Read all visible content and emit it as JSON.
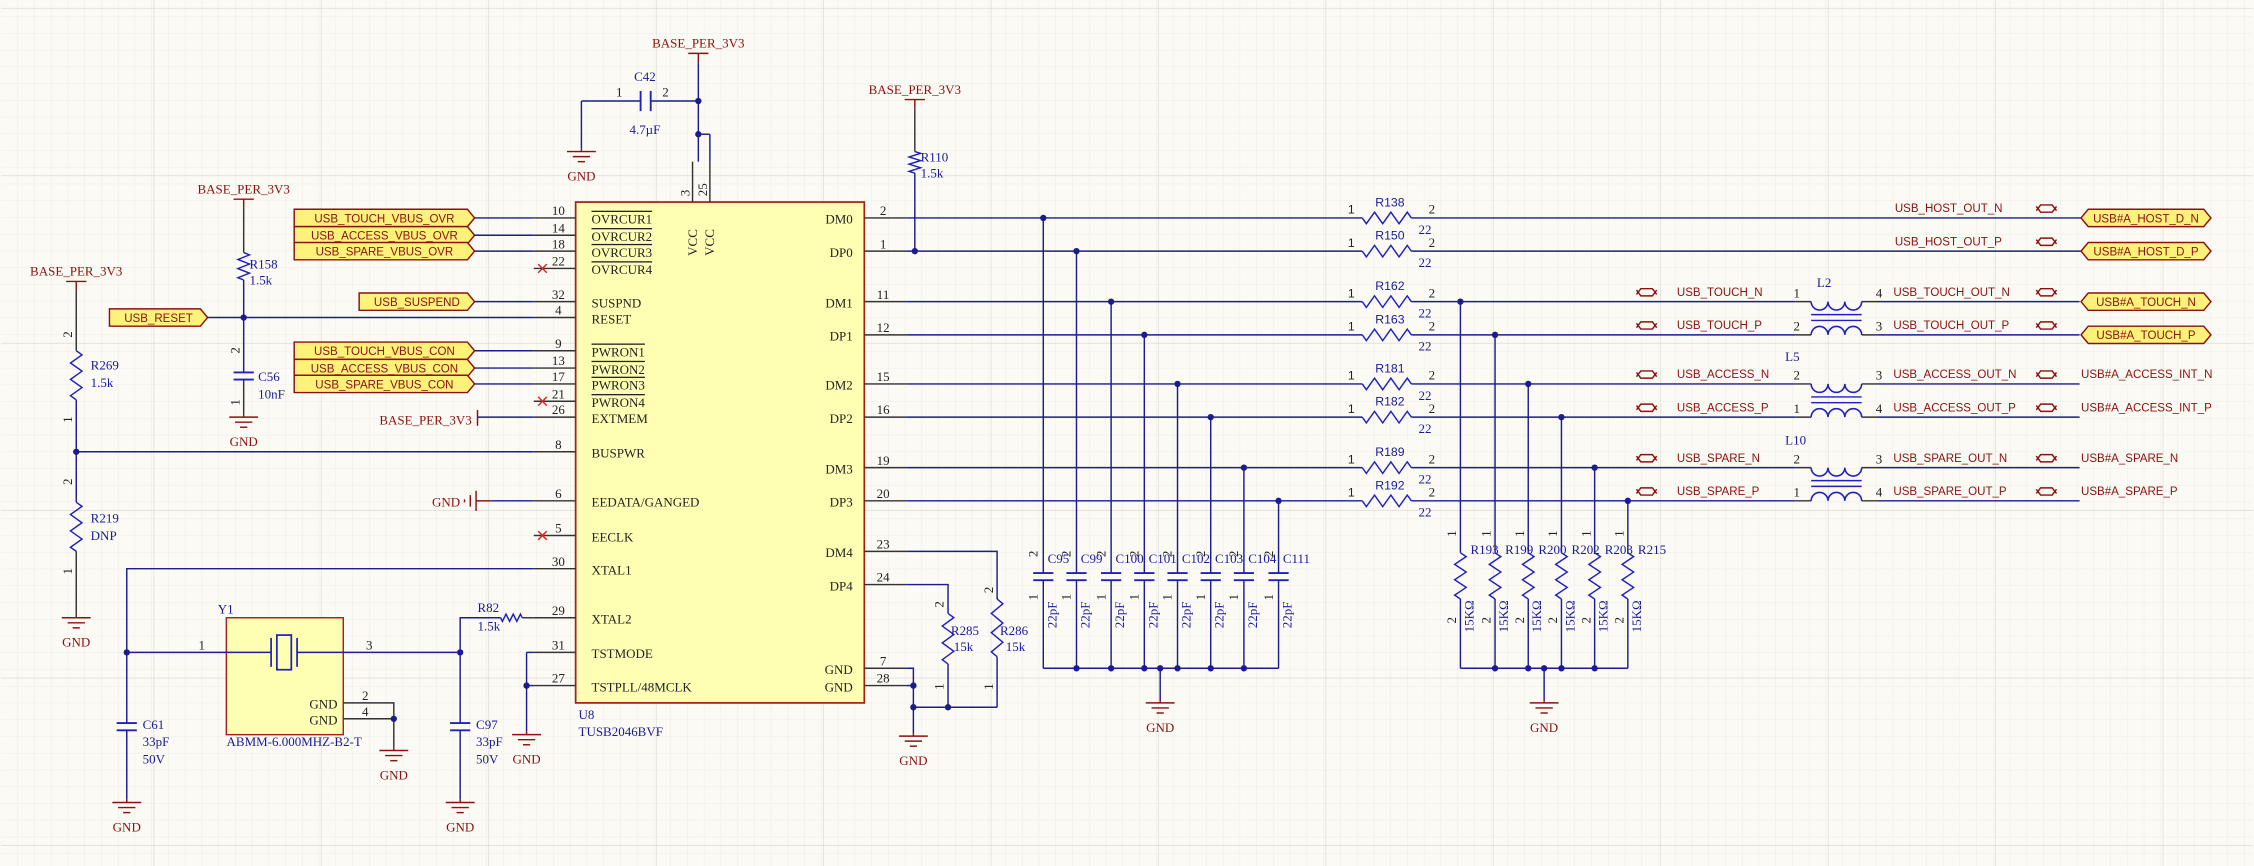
{
  "nets": {
    "power": "BASE_PER_3V3",
    "gnd": "GND"
  },
  "colors": {
    "wire": "#1c1c8f",
    "net_label": "#8b1010",
    "component_text": "#1a1a9a",
    "ic_fill": "#ffffb4",
    "ic_border": "#a02020",
    "port_fill": "#fff27a"
  },
  "u8": {
    "ref": "U8",
    "part": "TUSB2046BVF",
    "top": [
      {
        "num": "3",
        "name": "VCC"
      },
      {
        "num": "25",
        "name": "VCC"
      }
    ],
    "left": [
      {
        "num": "10",
        "name": "OVRCUR1",
        "active_low": true
      },
      {
        "num": "14",
        "name": "OVRCUR2",
        "active_low": true
      },
      {
        "num": "18",
        "name": "OVRCUR3",
        "active_low": true
      },
      {
        "num": "22",
        "name": "OVRCUR4",
        "active_low": true,
        "no_connect": true
      },
      {
        "num": "32",
        "name": "SUSPND"
      },
      {
        "num": "4",
        "name": "RESET"
      },
      {
        "num": "9",
        "name": "PWRON1",
        "active_low": true
      },
      {
        "num": "13",
        "name": "PWRON2",
        "active_low": true
      },
      {
        "num": "17",
        "name": "PWRON3",
        "active_low": true
      },
      {
        "num": "21",
        "name": "PWRON4",
        "active_low": true,
        "no_connect": true
      },
      {
        "num": "26",
        "name": "EXTMEM"
      },
      {
        "num": "8",
        "name": "BUSPWR"
      },
      {
        "num": "6",
        "name": "EEDATA/GANGED"
      },
      {
        "num": "5",
        "name": "EECLK",
        "no_connect": true
      },
      {
        "num": "30",
        "name": "XTAL1"
      },
      {
        "num": "29",
        "name": "XTAL2"
      },
      {
        "num": "31",
        "name": "TSTMODE"
      },
      {
        "num": "27",
        "name": "TSTPLL/48MCLK"
      }
    ],
    "right": [
      {
        "num": "2",
        "name": "DM0"
      },
      {
        "num": "1",
        "name": "DP0"
      },
      {
        "num": "11",
        "name": "DM1"
      },
      {
        "num": "12",
        "name": "DP1"
      },
      {
        "num": "15",
        "name": "DM2"
      },
      {
        "num": "16",
        "name": "DP2"
      },
      {
        "num": "19",
        "name": "DM3"
      },
      {
        "num": "20",
        "name": "DP3"
      },
      {
        "num": "23",
        "name": "DM4"
      },
      {
        "num": "24",
        "name": "DP4"
      },
      {
        "num": "7",
        "name": "GND"
      },
      {
        "num": "28",
        "name": "GND"
      }
    ]
  },
  "ports_left": {
    "ovr": [
      "USB_TOUCH_VBUS_OVR",
      "USB_ACCESS_VBUS_OVR",
      "USB_SPARE_VBUS_OVR"
    ],
    "suspend": "USB_SUSPEND",
    "reset": "USB_RESET",
    "con": [
      "USB_TOUCH_VBUS_CON",
      "USB_ACCESS_VBUS_CON",
      "USB_SPARE_VBUS_CON"
    ]
  },
  "pin_numbers": {
    "one": "1",
    "two": "2",
    "three": "3",
    "four": "4"
  },
  "components": {
    "C42": {
      "ref": "C42",
      "value": "4.7µF"
    },
    "R158": {
      "ref": "R158",
      "value": "1.5k"
    },
    "C56": {
      "ref": "C56",
      "value": "10nF"
    },
    "R269": {
      "ref": "R269",
      "value": "1.5k"
    },
    "R219": {
      "ref": "R219",
      "value": "DNP"
    },
    "R110": {
      "ref": "R110",
      "value": "1.5k"
    },
    "R82": {
      "ref": "R82",
      "value": "1.5k"
    },
    "C61": {
      "ref": "C61",
      "value": "33pF",
      "voltage": "50V"
    },
    "C97": {
      "ref": "C97",
      "value": "33pF",
      "voltage": "50V"
    },
    "Y1": {
      "ref": "Y1",
      "part": "ABMM-6.000MHZ-B2-T",
      "pin_labels": [
        "GND",
        "GND"
      ]
    },
    "R285": {
      "ref": "R285",
      "value": "15k"
    },
    "R286": {
      "ref": "R286",
      "value": "15k"
    }
  },
  "series_resistors": [
    {
      "ref": "R138",
      "value": "22"
    },
    {
      "ref": "R150",
      "value": "22"
    },
    {
      "ref": "R162",
      "value": "22"
    },
    {
      "ref": "R163",
      "value": "22"
    },
    {
      "ref": "R181",
      "value": "22"
    },
    {
      "ref": "R182",
      "value": "22"
    },
    {
      "ref": "R189",
      "value": "22"
    },
    {
      "ref": "R192",
      "value": "22"
    }
  ],
  "filter_caps": [
    {
      "ref": "C95",
      "value": "22pF"
    },
    {
      "ref": "C99",
      "value": "22pF"
    },
    {
      "ref": "C100",
      "value": "22pF"
    },
    {
      "ref": "C101",
      "value": "22pF"
    },
    {
      "ref": "C102",
      "value": "22pF"
    },
    {
      "ref": "C103",
      "value": "22pF"
    },
    {
      "ref": "C104",
      "value": "22pF"
    },
    {
      "ref": "C111",
      "value": "22pF"
    }
  ],
  "pulldowns": [
    {
      "ref": "R193",
      "value": "15KΩ"
    },
    {
      "ref": "R199",
      "value": "15KΩ"
    },
    {
      "ref": "R200",
      "value": "15KΩ"
    },
    {
      "ref": "R202",
      "value": "15KΩ"
    },
    {
      "ref": "R203",
      "value": "15KΩ"
    },
    {
      "ref": "R215",
      "value": "15KΩ"
    }
  ],
  "chokes": [
    {
      "ref": "L2",
      "pins": [
        "1",
        "4",
        "2",
        "3"
      ]
    },
    {
      "ref": "L5",
      "pins": [
        "2",
        "3",
        "1",
        "4"
      ]
    },
    {
      "ref": "L10",
      "pins": [
        "2",
        "3",
        "1",
        "4"
      ]
    }
  ],
  "host_nets": [
    "USB_HOST_OUT_N",
    "USB_HOST_OUT_P"
  ],
  "inner_nets": [
    "USB_TOUCH_N",
    "USB_TOUCH_P",
    "USB_ACCESS_N",
    "USB_ACCESS_P",
    "USB_SPARE_N",
    "USB_SPARE_P"
  ],
  "out_nets": [
    "USB_TOUCH_OUT_N",
    "USB_TOUCH_OUT_P",
    "USB_ACCESS_OUT_N",
    "USB_ACCESS_OUT_P",
    "USB_SPARE_OUT_N",
    "USB_SPARE_OUT_P"
  ],
  "ports_right": [
    "USB#A_HOST_D_N",
    "USB#A_HOST_D_P",
    "USB#A_TOUCH_N",
    "USB#A_TOUCH_P"
  ],
  "end_nets": [
    "USB#A_ACCESS_INT_N",
    "USB#A_ACCESS_INT_P",
    "USB#A_SPARE_N",
    "USB#A_SPARE_P"
  ]
}
